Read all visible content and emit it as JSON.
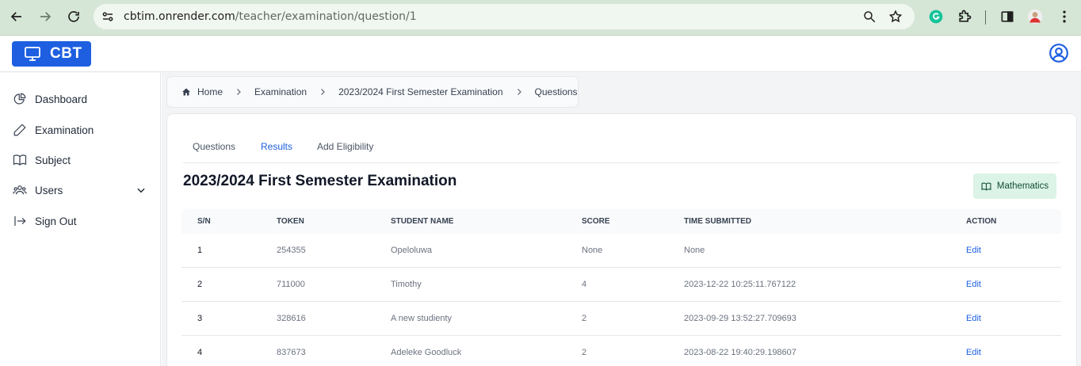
{
  "browser": {
    "url_host": "cbtim.onrender.com",
    "url_path": "/teacher/examination/question/1"
  },
  "app": {
    "logo_text": "CBT",
    "brand_color": "#1d5fe0"
  },
  "sidebar": {
    "items": [
      {
        "label": "Dashboard",
        "icon": "chart-pie-icon"
      },
      {
        "label": "Examination",
        "icon": "pencil-icon"
      },
      {
        "label": "Subject",
        "icon": "book-icon"
      },
      {
        "label": "Users",
        "icon": "users-icon"
      },
      {
        "label": "Sign Out",
        "icon": "sign-out-icon"
      }
    ]
  },
  "breadcrumb": [
    "Home",
    "Examination",
    "2023/2024 First Semester Examination",
    "Questions"
  ],
  "tabs": [
    {
      "label": "Questions",
      "active": false
    },
    {
      "label": "Results",
      "active": true
    },
    {
      "label": "Add Eligibility",
      "active": false
    }
  ],
  "page_title": "2023/2024 First Semester Examination",
  "subject_badge": "Mathematics",
  "table": {
    "headers": [
      "S/N",
      "TOKEN",
      "STUDENT NAME",
      "SCORE",
      "TIME SUBMITTED",
      "ACTION"
    ],
    "rows": [
      {
        "sn": "1",
        "token": "254355",
        "name": "Opeloluwa",
        "score": "None",
        "time": "None",
        "action": "Edit"
      },
      {
        "sn": "2",
        "token": "711000",
        "name": "Timothy",
        "score": "4",
        "time": "2023-12-22 10:25:11.767122",
        "action": "Edit"
      },
      {
        "sn": "3",
        "token": "328616",
        "name": "A new studienty",
        "score": "2",
        "time": "2023-09-29 13:52:27.709693",
        "action": "Edit"
      },
      {
        "sn": "4",
        "token": "837673",
        "name": "Adeleke Goodluck",
        "score": "2",
        "time": "2023-08-22 19:40:29.198607",
        "action": "Edit"
      }
    ]
  }
}
